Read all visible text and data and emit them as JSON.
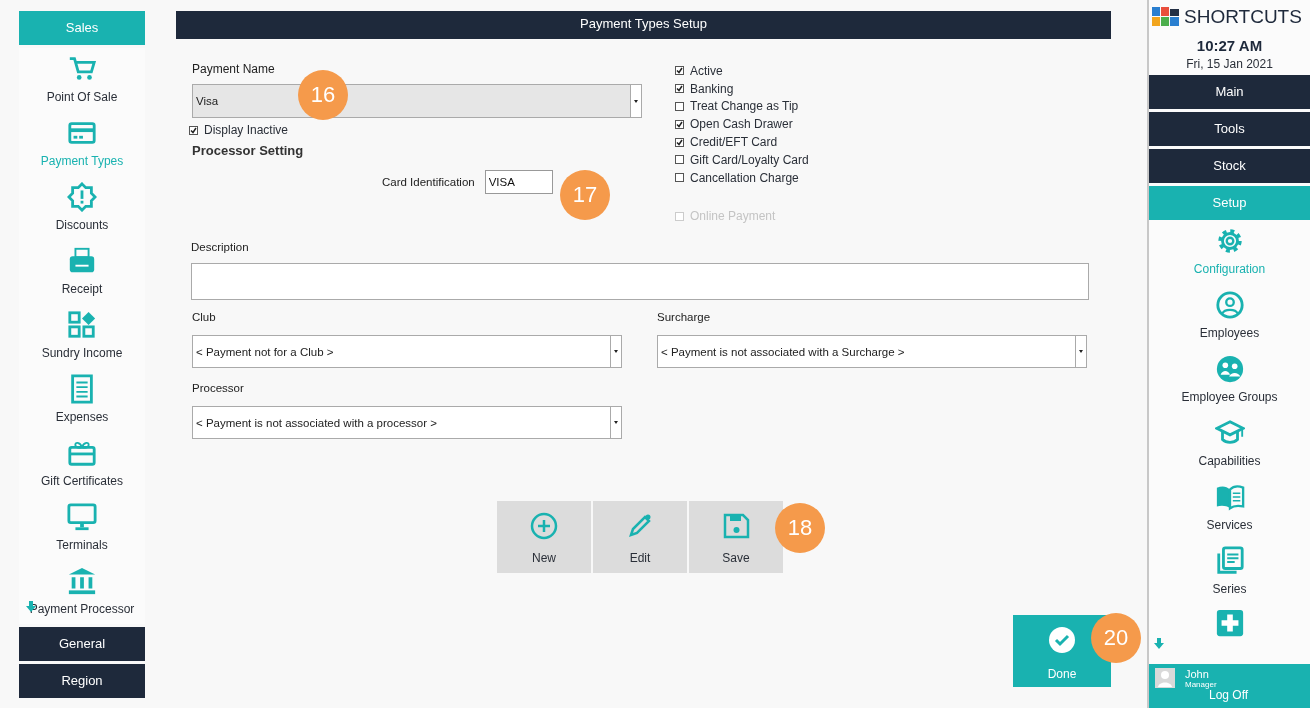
{
  "left_nav": {
    "groups": [
      {
        "label": "Sales",
        "selected": true
      },
      {
        "label": "General",
        "selected": false
      },
      {
        "label": "Region",
        "selected": false
      }
    ],
    "items": [
      {
        "label": "Point Of Sale",
        "selected": false
      },
      {
        "label": "Payment Types",
        "selected": true
      },
      {
        "label": "Discounts",
        "selected": false
      },
      {
        "label": "Receipt",
        "selected": false
      },
      {
        "label": "Sundry Income",
        "selected": false
      },
      {
        "label": "Expenses",
        "selected": false
      },
      {
        "label": "Gift Certificates",
        "selected": false
      },
      {
        "label": "Terminals",
        "selected": false
      },
      {
        "label": "Payment Processor",
        "selected": false
      }
    ]
  },
  "main": {
    "title": "Payment Types Setup",
    "payment_name": {
      "label": "Payment Name",
      "value": "Visa"
    },
    "display_inactive": {
      "label": "Display Inactive",
      "checked": true
    },
    "section_heading": "Processor Setting",
    "card_identification": {
      "label": "Card Identification",
      "value": "VISA"
    },
    "options": [
      {
        "label": "Active",
        "checked": true,
        "disabled": false
      },
      {
        "label": "Banking",
        "checked": true,
        "disabled": false
      },
      {
        "label": "Treat Change as Tip",
        "checked": false,
        "disabled": false
      },
      {
        "label": "Open Cash Drawer",
        "checked": true,
        "disabled": false
      },
      {
        "label": "Credit/EFT Card",
        "checked": true,
        "disabled": false
      },
      {
        "label": "Gift Card/Loyalty Card",
        "checked": false,
        "disabled": false
      },
      {
        "label": "Cancellation Charge",
        "checked": false,
        "disabled": false
      },
      {
        "label": "Online Payment",
        "checked": false,
        "disabled": true
      }
    ],
    "description": {
      "label": "Description"
    },
    "club": {
      "label": "Club",
      "value": "< Payment not for a Club >"
    },
    "surcharge": {
      "label": "Surcharge",
      "value": "< Payment is not associated with a Surcharge >"
    },
    "processor": {
      "label": "Processor",
      "value": "< Payment is not associated with a processor >"
    },
    "actions": [
      "New",
      "Edit",
      "Save"
    ],
    "done": "Done"
  },
  "callouts": [
    "16",
    "17",
    "18",
    "20"
  ],
  "right_panel": {
    "brand": "SHORTCUTS",
    "time": "10:27 AM",
    "date": "Fri, 15 Jan 2021",
    "groups": [
      {
        "label": "Main",
        "selected": false
      },
      {
        "label": "Tools",
        "selected": false
      },
      {
        "label": "Stock",
        "selected": false
      },
      {
        "label": "Setup",
        "selected": true
      }
    ],
    "items": [
      {
        "label": "Configuration",
        "selected": true
      },
      {
        "label": "Employees",
        "selected": false
      },
      {
        "label": "Employee Groups",
        "selected": false
      },
      {
        "label": "Capabilities",
        "selected": false
      },
      {
        "label": "Services",
        "selected": false
      },
      {
        "label": "Series",
        "selected": false
      }
    ],
    "user": {
      "name": "John",
      "role": "Manager",
      "action": "Log Off"
    }
  }
}
